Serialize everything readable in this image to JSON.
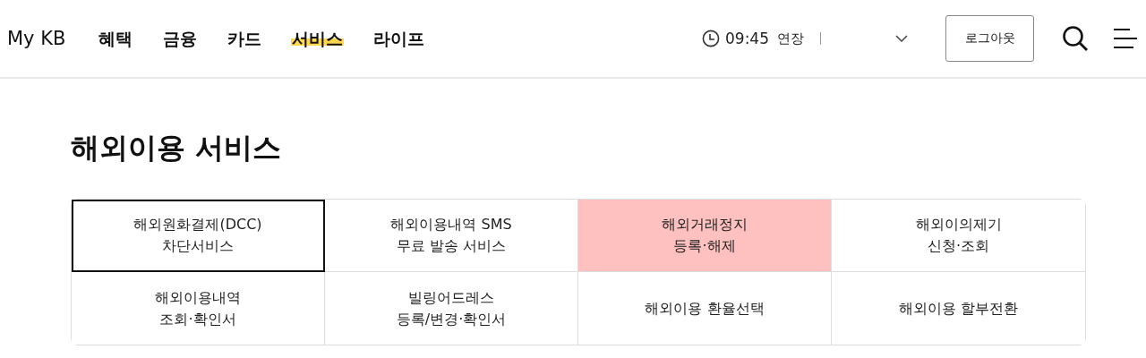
{
  "header": {
    "logo": "My KB",
    "nav": [
      {
        "label": "혜택",
        "selected": false
      },
      {
        "label": "금융",
        "selected": false
      },
      {
        "label": "카드",
        "selected": false
      },
      {
        "label": "서비스",
        "selected": true
      },
      {
        "label": "라이프",
        "selected": false
      }
    ],
    "session_time": "09:45",
    "extend_label": "연장",
    "logout_button": "로그아웃"
  },
  "page_title": "해외이용 서비스",
  "service_tabs": [
    {
      "label": "해외원화결제(DCC)\n차단서비스",
      "selected": true,
      "highlighted": false
    },
    {
      "label": "해외이용내역 SMS\n무료 발송 서비스",
      "selected": false,
      "highlighted": false
    },
    {
      "label": "해외거래정지\n등록·해제",
      "selected": false,
      "highlighted": true
    },
    {
      "label": "해외이의제기\n신청·조회",
      "selected": false,
      "highlighted": false
    },
    {
      "label": "해외이용내역\n조회·확인서",
      "selected": false,
      "highlighted": false
    },
    {
      "label": "빌링어드레스\n등록/변경·확인서",
      "selected": false,
      "highlighted": false
    },
    {
      "label": "해외이용 환율선택",
      "selected": false,
      "highlighted": false
    },
    {
      "label": "해외이용 할부전환",
      "selected": false,
      "highlighted": false
    }
  ]
}
